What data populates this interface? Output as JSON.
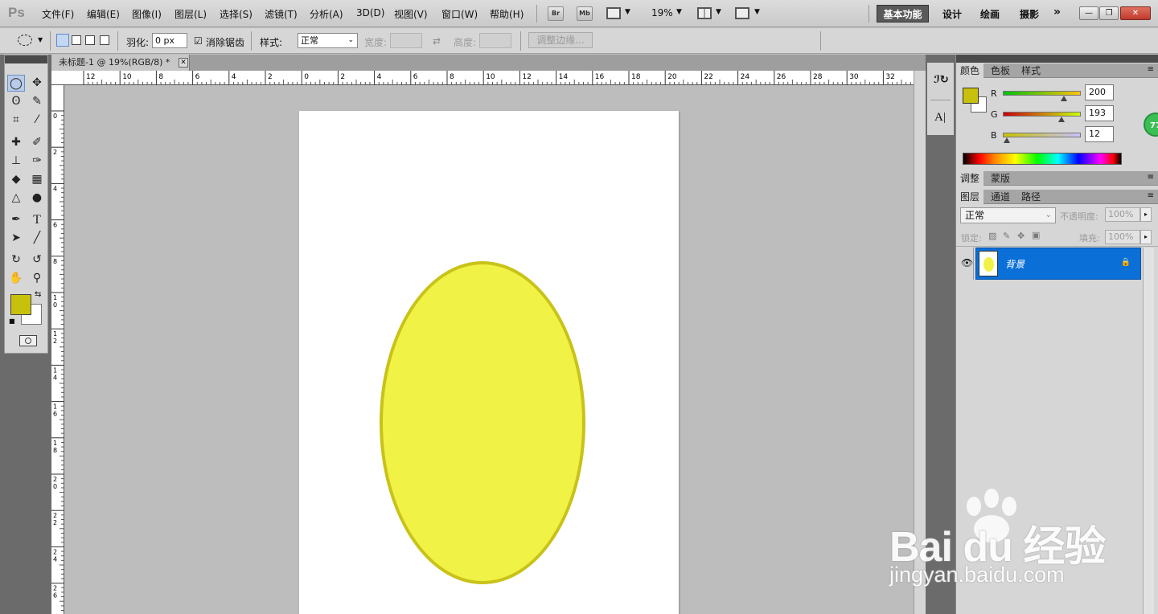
{
  "app": {
    "logo": "Ps"
  },
  "menu": [
    "文件(F)",
    "编辑(E)",
    "图像(I)",
    "图层(L)",
    "选择(S)",
    "滤镜(T)",
    "分析(A)",
    "3D(D)",
    "视图(V)",
    "窗口(W)",
    "帮助(H)"
  ],
  "app_bar": {
    "bridge": "Br",
    "mini_bridge": "Mb",
    "zoom": "19%"
  },
  "workspaces": {
    "active": "基本功能",
    "items": [
      "设计",
      "绘画",
      "摄影"
    ],
    "more": "»"
  },
  "window_controls": {
    "minimize": "—",
    "restore": "❐",
    "close": "✕"
  },
  "options": {
    "feather_label": "羽化:",
    "feather_value": "0 px",
    "antialias_label": "消除锯齿",
    "style_label": "样式:",
    "style_value": "正常",
    "width_label": "宽度:",
    "height_label": "高度:",
    "refine_edge": "调整边缘..."
  },
  "document": {
    "tab_title": "未标题-1 @ 19%(RGB/8) *",
    "close": "✕"
  },
  "rulers": {
    "h_labels": [
      "12",
      "10",
      "8",
      "6",
      "4",
      "2",
      "0",
      "2",
      "4",
      "6",
      "8",
      "10",
      "12",
      "14",
      "16",
      "18",
      "20",
      "22",
      "24",
      "26",
      "28",
      "30",
      "32"
    ],
    "v_labels": [
      "0",
      "2",
      "4",
      "6",
      "8",
      "10",
      "12",
      "14",
      "16",
      "18",
      "20",
      "22",
      "24",
      "26"
    ]
  },
  "canvas": {
    "shape": "ellipse",
    "fill": "#f0f245",
    "stroke": "#c9c219"
  },
  "colors": {
    "foreground": "#c8c10c",
    "background": "#ffffff"
  },
  "color_panel": {
    "tabs": [
      "颜色",
      "色板",
      "样式"
    ],
    "channels": [
      {
        "label": "R",
        "value": "200"
      },
      {
        "label": "G",
        "value": "193"
      },
      {
        "label": "B",
        "value": "12"
      }
    ],
    "channel_levels": [
      0.784,
      0.757,
      0.047
    ]
  },
  "adjust_panel": {
    "tabs": [
      "调整",
      "蒙版"
    ]
  },
  "layers_panel": {
    "tabs": [
      "图层",
      "通道",
      "路径"
    ],
    "blend_mode": "正常",
    "opacity_label": "不透明度:",
    "opacity_value": "100%",
    "lock_label": "锁定:",
    "fill_label": "填充:",
    "fill_value": "100%",
    "layers": [
      {
        "name": "背景",
        "visible": true,
        "locked": true
      }
    ]
  },
  "watermark": {
    "brand": "Bai du 经验",
    "url": "jingyan.baidu.com"
  },
  "badge": {
    "text": "77"
  }
}
